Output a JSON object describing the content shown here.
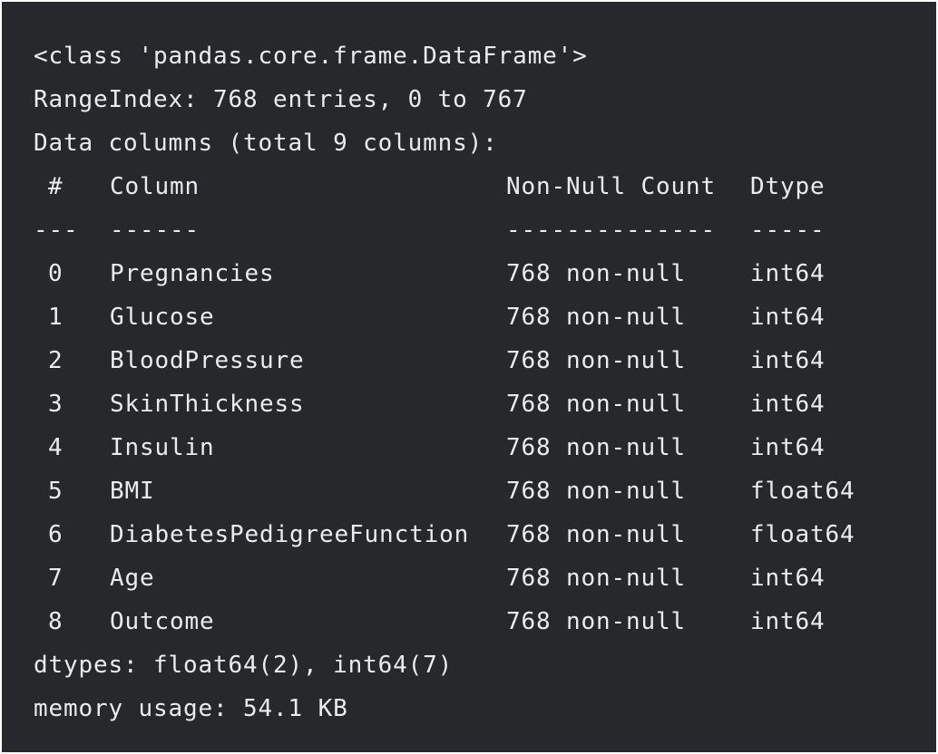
{
  "output": {
    "class_line": "<class 'pandas.core.frame.DataFrame'>",
    "range_index": "RangeIndex: 768 entries, 0 to 767",
    "data_columns": "Data columns (total 9 columns):",
    "header": {
      "hash": "#",
      "column": "Column",
      "non_null": "Non-Null Count",
      "dtype": "Dtype"
    },
    "separator": {
      "hash": "---",
      "column": "------",
      "non_null": "--------------",
      "dtype": "-----"
    },
    "rows": [
      {
        "idx": "0",
        "name": "Pregnancies",
        "count": "768 non-null",
        "dtype": "int64"
      },
      {
        "idx": "1",
        "name": "Glucose",
        "count": "768 non-null",
        "dtype": "int64"
      },
      {
        "idx": "2",
        "name": "BloodPressure",
        "count": "768 non-null",
        "dtype": "int64"
      },
      {
        "idx": "3",
        "name": "SkinThickness",
        "count": "768 non-null",
        "dtype": "int64"
      },
      {
        "idx": "4",
        "name": "Insulin",
        "count": "768 non-null",
        "dtype": "int64"
      },
      {
        "idx": "5",
        "name": "BMI",
        "count": "768 non-null",
        "dtype": "float64"
      },
      {
        "idx": "6",
        "name": "DiabetesPedigreeFunction",
        "count": "768 non-null",
        "dtype": "float64"
      },
      {
        "idx": "7",
        "name": "Age",
        "count": "768 non-null",
        "dtype": "int64"
      },
      {
        "idx": "8",
        "name": "Outcome",
        "count": "768 non-null",
        "dtype": "int64"
      }
    ],
    "dtypes_line": "dtypes: float64(2), int64(7)",
    "memory_line": "memory usage: 54.1 KB"
  }
}
